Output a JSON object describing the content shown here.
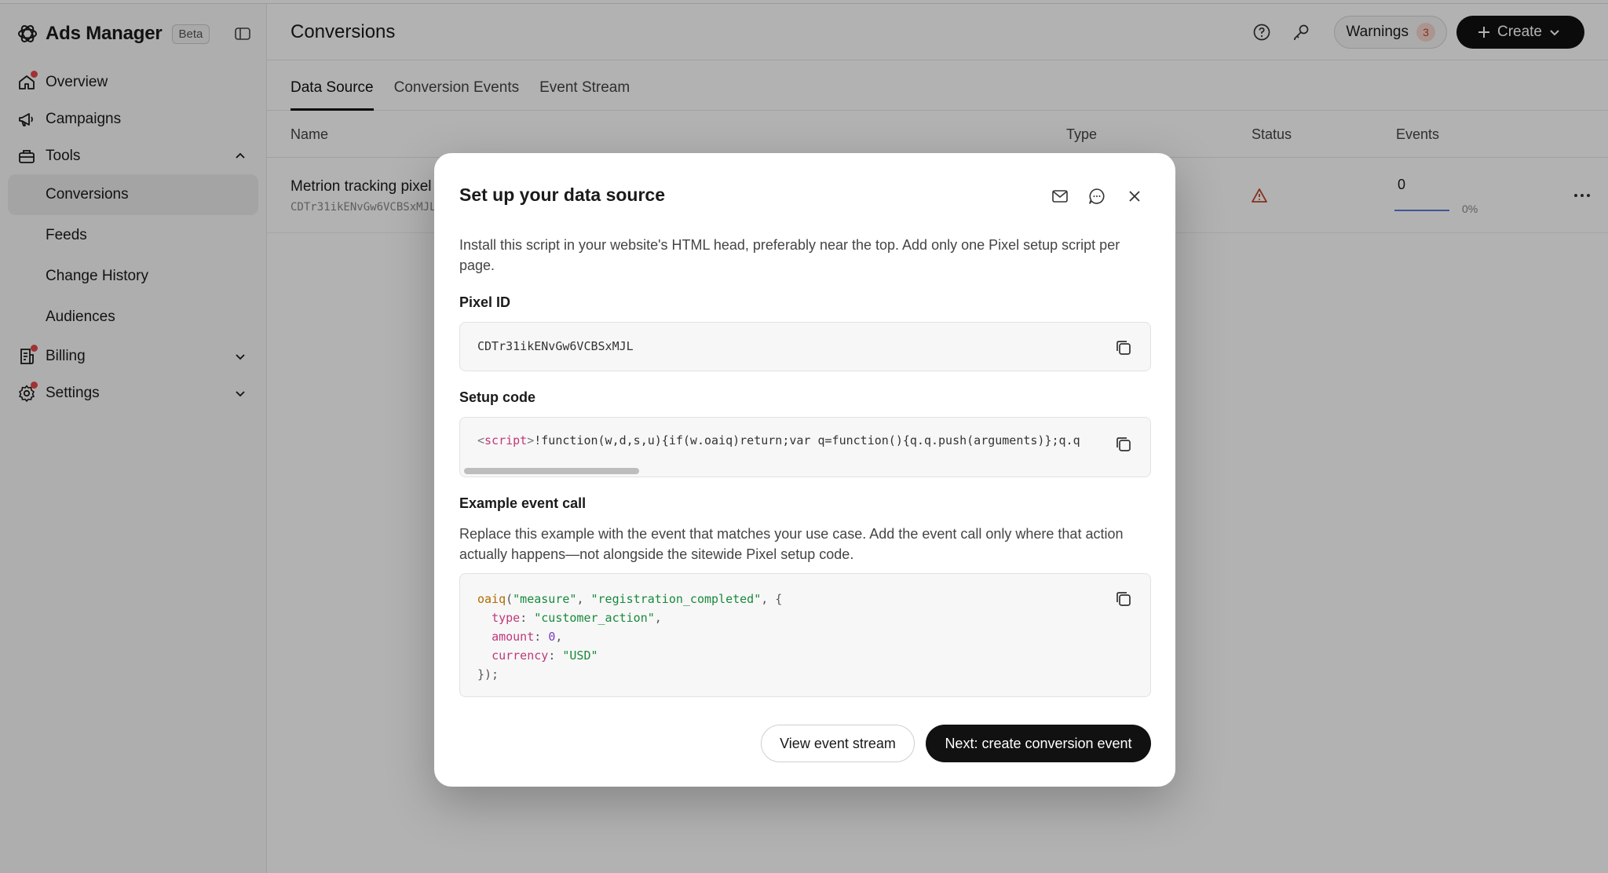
{
  "brand": {
    "title": "Ads Manager",
    "badge": "Beta"
  },
  "sidebar": {
    "items": [
      {
        "label": "Overview",
        "icon": "home-icon",
        "notification": true
      },
      {
        "label": "Campaigns",
        "icon": "megaphone-icon",
        "notification": false
      },
      {
        "label": "Tools",
        "icon": "toolbox-icon",
        "notification": false,
        "expanded": true
      },
      {
        "label": "Billing",
        "icon": "receipt-icon",
        "notification": true,
        "expanded": false
      },
      {
        "label": "Settings",
        "icon": "gear-icon",
        "notification": true,
        "expanded": false
      }
    ],
    "tools_children": [
      {
        "label": "Conversions",
        "active": true
      },
      {
        "label": "Feeds",
        "active": false
      },
      {
        "label": "Change History",
        "active": false
      },
      {
        "label": "Audiences",
        "active": false
      }
    ]
  },
  "header": {
    "title": "Conversions",
    "warnings_label": "Warnings",
    "warnings_count": "3",
    "create_label": "Create"
  },
  "tabs": [
    {
      "label": "Data Source",
      "active": true
    },
    {
      "label": "Conversion Events",
      "active": false
    },
    {
      "label": "Event Stream",
      "active": false
    }
  ],
  "table": {
    "columns": [
      "Name",
      "Type",
      "Status",
      "Events"
    ],
    "rows": [
      {
        "name": "Metrion tracking pixel",
        "id": "CDTr31ikENvGw6VCBSxMJL",
        "status": "warning",
        "events": "0",
        "events_pct": "0%",
        "events_progress": 0
      }
    ]
  },
  "modal": {
    "title": "Set up your data source",
    "description": "Install this script in your website's HTML head, preferably near the top. Add only one Pixel setup script per page.",
    "pixel_id_label": "Pixel ID",
    "pixel_id": "CDTr31ikENvGw6VCBSxMJL",
    "setup_code_label": "Setup code",
    "setup_code_open": "<",
    "setup_code_tag": "script",
    "setup_code_close": ">",
    "setup_code_body": "!function(w,d,s,u){if(w.oaiq)return;var q=function(){q.q.push(arguments)};q.q",
    "example_label": "Example event call",
    "example_description": "Replace this example with the event that matches your use case. Add the event call only where that action actually happens—not alongside the sitewide Pixel setup code.",
    "example_code": {
      "fn": "oaiq",
      "arg1": "\"measure\"",
      "arg2": "\"registration_completed\"",
      "type_key": "type",
      "type_val": "\"customer_action\"",
      "amount_key": "amount",
      "amount_val": "0",
      "currency_key": "currency",
      "currency_val": "\"USD\"",
      "close": "});"
    },
    "secondary_button": "View event stream",
    "primary_button": "Next: create conversion event"
  },
  "colors": {
    "accent": "#111111",
    "notification": "#e5484d",
    "warning": "#c1462b",
    "progress": "#5b7bd5"
  }
}
